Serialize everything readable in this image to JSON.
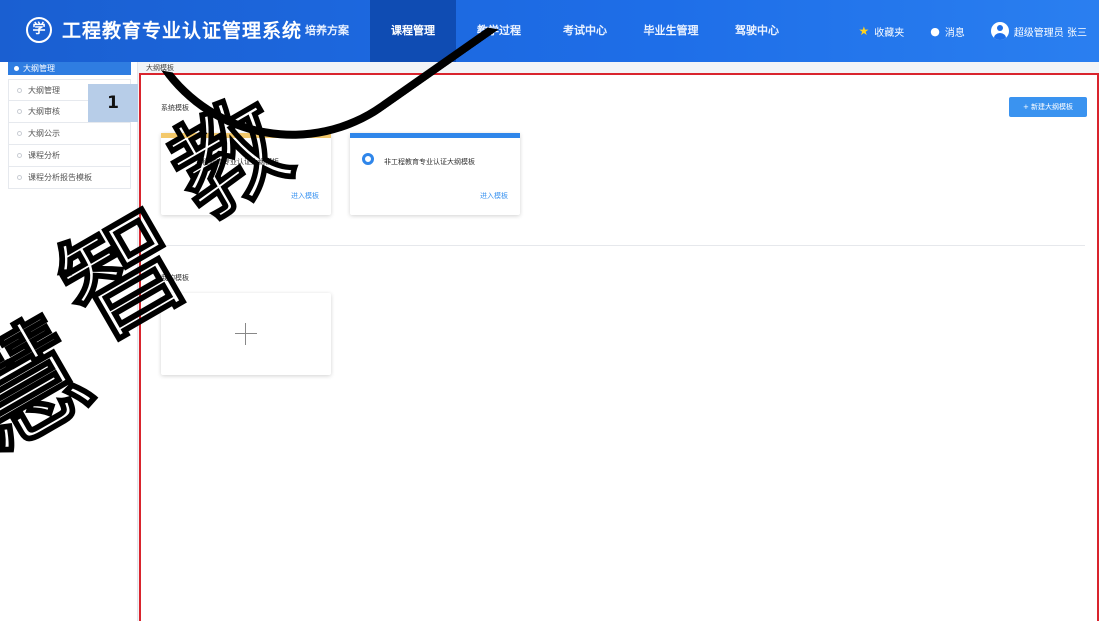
{
  "header": {
    "logo_char": "学",
    "title": "工程教育专业认证管理系统",
    "nav": [
      "培养方案",
      "课程管理",
      "教学过程",
      "考试中心",
      "毕业生管理",
      "驾驶中心"
    ],
    "favorites": "收藏夹",
    "messages": "消息",
    "user": "超级管理员 张三"
  },
  "sidebar": {
    "header": "大纲管理",
    "items": [
      "大纲管理",
      "大纲审核",
      "大纲公示",
      "课程分析",
      "课程分析报告模板"
    ],
    "badge": "1"
  },
  "breadcrumb": "大纲模板",
  "main": {
    "system_templates_title": "系统模板",
    "new_button": "+ 新建大纲模板",
    "cards": [
      {
        "name": "工程教育专业认证大纲模板",
        "enter": "进入模板",
        "color": "#f3c86a"
      },
      {
        "name": "非工程教育专业认证大纲模板",
        "enter": "进入模板",
        "color": "#2f86ea"
      }
    ],
    "my_templates_title": "我的模板"
  },
  "watermark": [
    "智",
    "慧",
    "教"
  ]
}
